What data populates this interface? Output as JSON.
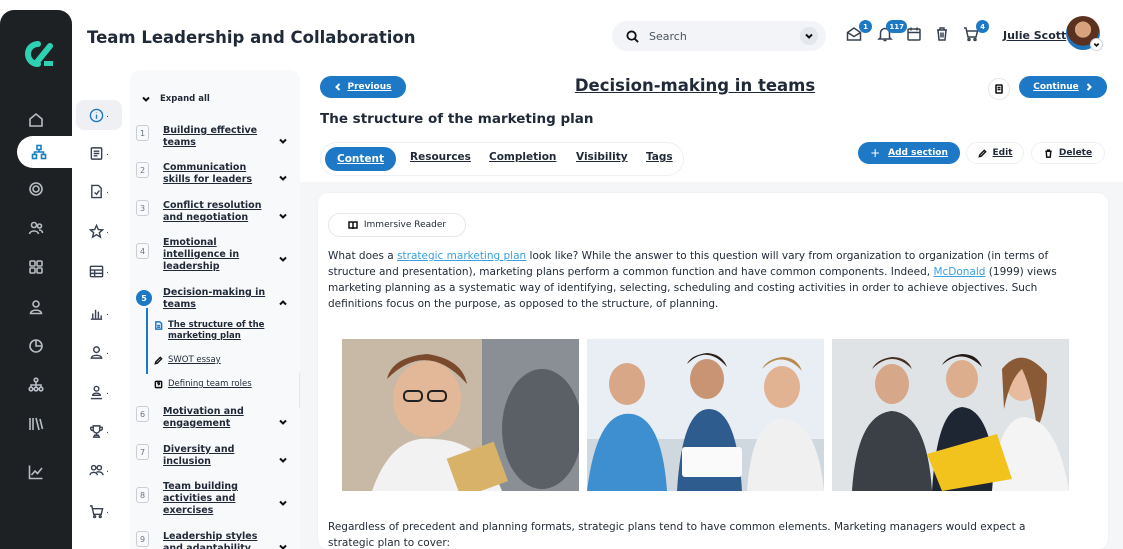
{
  "app": {
    "title": "Team Leadership and Collaboration",
    "logo_text": "α"
  },
  "header": {
    "search_placeholder": "Search",
    "badges": {
      "messages": "1",
      "notifications": "117",
      "cart": "4"
    },
    "user_name": "Julie Scott"
  },
  "colors": {
    "accent": "#1d78c5",
    "rail": "#1e2124",
    "logo": "#2fd1b3",
    "link": "#3aa0e0"
  },
  "rail_icons": [
    "home-icon",
    "org-chart-icon",
    "target-icon",
    "users-icon",
    "grid-icon",
    "user-icon",
    "pie-chart-icon",
    "hierarchy-icon",
    "library-icon",
    "line-chart-icon"
  ],
  "col_icons": [
    "info-icon",
    "notes-icon",
    "document-icon",
    "star-icon",
    "table-icon",
    "bar-chart-icon",
    "person-icon",
    "org-person-icon",
    "trophy-icon",
    "group-icon",
    "cart-icon"
  ],
  "col_icons_suffix": ".",
  "chapters": {
    "expand_all": "Expand all",
    "items": [
      {
        "num": "1",
        "label": "Building effective teams"
      },
      {
        "num": "2",
        "label": "Communication skills for leaders"
      },
      {
        "num": "3",
        "label": "Conflict resolution and negotiation"
      },
      {
        "num": "4",
        "label": "Emotional intelligence in leadership"
      },
      {
        "num": "5",
        "label": "Decision-making in teams"
      },
      {
        "num": "6",
        "label": "Motivation and engagement"
      },
      {
        "num": "7",
        "label": "Diversity and inclusion"
      },
      {
        "num": "8",
        "label": "Team building activities and exercises"
      },
      {
        "num": "9",
        "label": "Leadership styles and adaptability"
      }
    ],
    "subitems": [
      {
        "label": "The structure of the marketing plan"
      },
      {
        "label": "SWOT essay"
      },
      {
        "label": "Defining team roles"
      }
    ]
  },
  "lesson": {
    "previous": "Previous",
    "title": "Decision-making in teams",
    "continue": "Continue",
    "section_title": "The structure of the marketing plan",
    "tabs": [
      "Content",
      "Resources",
      "Completion",
      "Visibility",
      "Tags"
    ],
    "add_section": "Add section",
    "edit": "Edit",
    "delete": "Delete",
    "immersive_reader": "Immersive Reader",
    "para1": {
      "pre": "What does a ",
      "link1": "strategic marketing plan",
      "mid": " look like? While the answer to this question will vary from organization to organization (in terms of structure and presentation), marketing plans perform a common function and have common components. Indeed, ",
      "link2": "McDonald",
      "post": " (1999) views marketing planning as a systematic way of identifying, selecting, scheduling and costing activities in order to achieve objectives. Such definitions focus on the purpose, as opposed to the structure, of planning."
    },
    "para2": "Regardless of precedent and planning formats, strategic plans tend to have common elements. Marketing managers would expect a strategic plan to cover:"
  }
}
